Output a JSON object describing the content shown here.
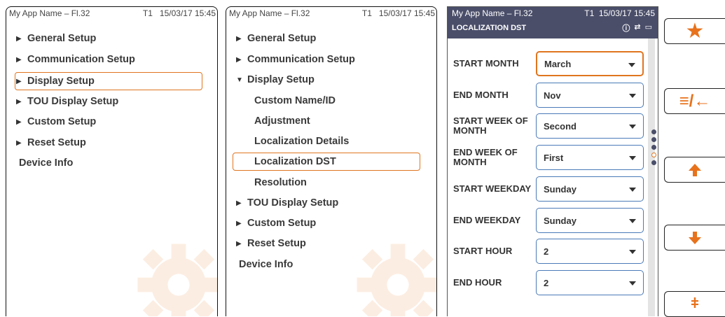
{
  "status": {
    "app_name": "My App Name – Fl.32",
    "t_id": "T1",
    "datetime": "15/03/17 15:45"
  },
  "panel1": {
    "items": [
      "General Setup",
      "Communication Setup",
      "Display Setup",
      "TOU Display Setup",
      "Custom Setup",
      "Reset Setup"
    ],
    "device_info": "Device Info"
  },
  "panel2": {
    "items": [
      "General Setup",
      "Communication Setup",
      "Display Setup"
    ],
    "subitems": [
      "Custom Name/ID",
      "Adjustment",
      "Localization Details",
      "Localization DST",
      "Resolution"
    ],
    "items_after": [
      "TOU Display Setup",
      "Custom Setup",
      "Reset Setup"
    ],
    "device_info": "Device Info"
  },
  "panel3": {
    "title": "LOCALIZATION DST",
    "fields": [
      {
        "label": "START MONTH",
        "value": "March"
      },
      {
        "label": "END MONTH",
        "value": "Nov"
      },
      {
        "label": "START WEEK OF MONTH",
        "value": "Second"
      },
      {
        "label": "END WEEK OF MONTH",
        "value": "First"
      },
      {
        "label": "START WEEKDAY",
        "value": "Sunday"
      },
      {
        "label": "END WEEKDAY",
        "value": "Sunday"
      },
      {
        "label": "START HOUR",
        "value": "2"
      },
      {
        "label": "END HOUR",
        "value": "2"
      }
    ],
    "page_dots": 5,
    "current_page": 4
  },
  "softkeys": [
    {
      "icon": "star-icon",
      "glyph": "★"
    },
    {
      "icon": "back-list-icon",
      "glyph": "≡/←"
    },
    {
      "icon": "up-arrow-icon",
      "glyph": "🡅"
    },
    {
      "icon": "down-arrow-icon",
      "glyph": "🡇"
    },
    {
      "icon": "lightning-icon",
      "glyph": "↯"
    }
  ],
  "colors": {
    "accent": "#e0751f",
    "header": "#4a4e69",
    "field_border": "#4a7ab8"
  }
}
